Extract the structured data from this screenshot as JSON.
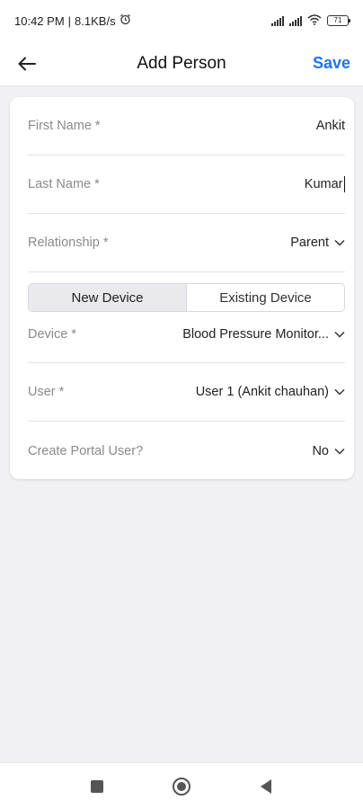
{
  "status_bar": {
    "time": "10:42 PM",
    "net_speed": "8.1KB/s",
    "alarm_icon": "alarm-clock-icon",
    "battery_level": "71"
  },
  "app_bar": {
    "back_icon": "arrow-left-icon",
    "title": "Add Person",
    "save_label": "Save",
    "accent_color": "#1f74e6"
  },
  "form": {
    "first_name": {
      "label": "First Name *",
      "value": "Ankit"
    },
    "last_name": {
      "label": "Last Name *",
      "value": "Kumar"
    },
    "relationship": {
      "label": "Relationship *",
      "value": "Parent"
    },
    "device_tabs": {
      "new_device": "New Device",
      "existing_device": "Existing Device",
      "selected": "New Device"
    },
    "device": {
      "label": "Device *",
      "value": "Blood Pressure Monitor..."
    },
    "user": {
      "label": "User *",
      "value": "User 1 (Ankit chauhan)"
    },
    "portal_user": {
      "label": "Create Portal User?",
      "value": "No"
    }
  },
  "nav_bar": {
    "recents_icon": "square-icon",
    "home_icon": "circle-icon",
    "back_icon": "triangle-back-icon"
  }
}
